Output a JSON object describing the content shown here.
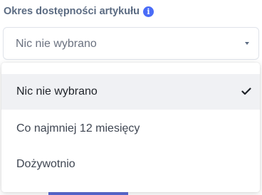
{
  "field": {
    "label": "Okres dostępności artykułu",
    "info_icon": "info-icon",
    "info_glyph": "i",
    "selected_value": "Nic nie wybrano"
  },
  "dropdown": {
    "options": [
      {
        "label": "Nic nie wybrano",
        "selected": true
      },
      {
        "label": "Co najmniej 12 miesięcy",
        "selected": false
      },
      {
        "label": "Dożywotnio",
        "selected": false
      }
    ]
  },
  "colors": {
    "label_text": "#5b6b82",
    "info_icon": "#4a6cf7",
    "selected_option_bg": "#f0f1f4",
    "button_behind": "#5c6bd6"
  }
}
